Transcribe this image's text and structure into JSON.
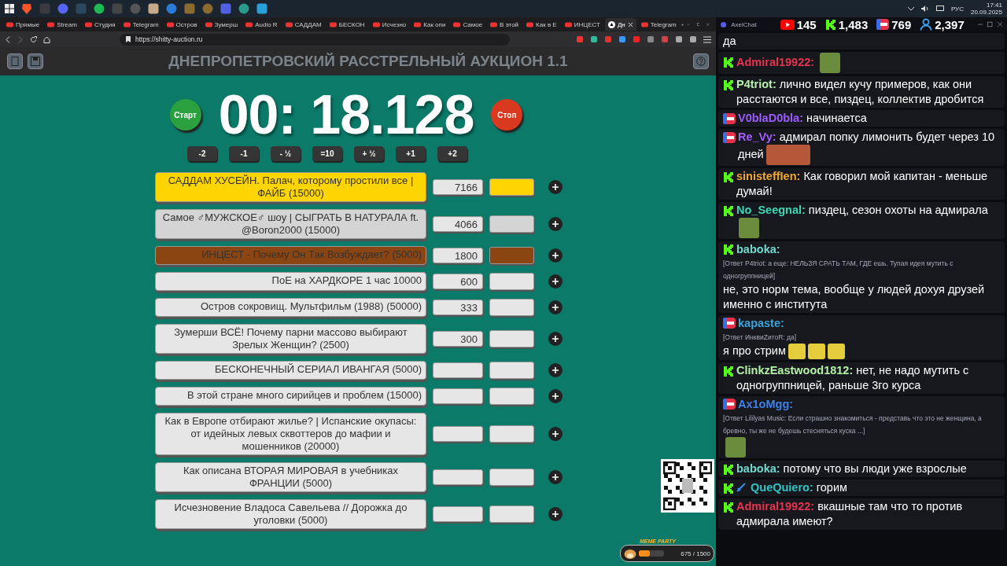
{
  "taskbar": {
    "language": "РУС",
    "time": "17:41",
    "date": "20.09.2025"
  },
  "browser": {
    "tabs": [
      {
        "label": "Прямые",
        "selected": false
      },
      {
        "label": "Stream",
        "selected": false
      },
      {
        "label": "Студия",
        "selected": false
      },
      {
        "label": "Telegram",
        "selected": false
      },
      {
        "label": "Остров",
        "selected": false
      },
      {
        "label": "Зумерш",
        "selected": false
      },
      {
        "label": "Audio R",
        "selected": false
      },
      {
        "label": "САДДАМ",
        "selected": false
      },
      {
        "label": "БЕСКОН",
        "selected": false
      },
      {
        "label": "Исчезно",
        "selected": false
      },
      {
        "label": "Как опи",
        "selected": false
      },
      {
        "label": "Самое",
        "selected": false
      },
      {
        "label": "В этой",
        "selected": false
      },
      {
        "label": "Как в Е",
        "selected": false
      },
      {
        "label": "ИНЦЕСТ",
        "selected": false
      },
      {
        "label": "Дн",
        "selected": true
      },
      {
        "label": "Telegram",
        "selected": false
      }
    ],
    "address": "https://shitty-auction.ru"
  },
  "auction": {
    "title": "ДНЕПРОПЕТРОВСКИЙ РАССТРЕЛЬНЫЙ АУКЦИОН 1.1",
    "timer": "00: 18.128",
    "start_button": "Старт",
    "stop_button": "Стоп",
    "time_buttons": [
      "-2",
      "-1",
      "- ½",
      "=10",
      "+ ½",
      "+1",
      "+2"
    ],
    "lots": [
      {
        "name": "САДДАМ ХУСЕЙН. Палач, которому простили все | ФАЙБ (15000)",
        "amount": "7166",
        "color": "#ffd500"
      },
      {
        "name": "Самое ♂МУЖСКОЕ♂ шоу | СЫГРАТЬ В НАТУРАЛА ft. @Boron2000 (15000)",
        "amount": "4066",
        "color": "#d4d4d4"
      },
      {
        "name": "ИНЦЕСТ - Почему Он Так Возбуждает? (5000)",
        "amount": "1800",
        "color": "#8b4513"
      },
      {
        "name": "ПоЕ на ХАРДКОРЕ 1 час 10000",
        "amount": "600",
        "color": "#e6e6e6"
      },
      {
        "name": "Остров сокровищ. Мультфильм (1988) (50000)",
        "amount": "333",
        "color": "#e6e6e6"
      },
      {
        "name": "Зумерши ВСЁ! Почему парни массово выбирают Зрелых Женщин? (2500)",
        "amount": "300",
        "color": "#e6e6e6"
      },
      {
        "name": "БЕСКОНЕЧНЫЙ СЕРИАЛ ИВАНГАЯ (5000)",
        "color": "#e6e6e6"
      },
      {
        "name": "В этой стране много сирийцев и проблем (15000)",
        "color": "#e6e6e6"
      },
      {
        "name": "Как в Европе отбирают жилье? | Испанские окупасы: от идейных левых сквоттеров до мафии и мошенников (20000)",
        "color": "#e6e6e6"
      },
      {
        "name": "Как описана ВТОРАЯ МИРОВАЯ в учебниках ФРАНЦИИ (5000)",
        "color": "#e6e6e6"
      },
      {
        "name": "Исчезновение Владоса Савельева // Дорожка до уголовки (5000)",
        "color": "#e6e6e6"
      }
    ]
  },
  "widget": {
    "title": "MEME PARTY",
    "progress": "675 / 1500",
    "level": 0.45
  },
  "chat": {
    "title": "AxelChat",
    "counters": [
      {
        "kind": "youtube",
        "value": "145"
      },
      {
        "kind": "kick",
        "value": "1,483"
      },
      {
        "kind": "live",
        "value": "769"
      },
      {
        "kind": "viewers",
        "value": "2,397"
      }
    ],
    "messages": [
      {
        "kind": "plain",
        "text": "да"
      },
      {
        "kind": "kick",
        "author": "Admiral19922:",
        "color": "#e8334f",
        "emotes": [
          {
            "kind": "square"
          }
        ]
      },
      {
        "kind": "kick",
        "author": "P4triot:",
        "color": "#b8f0b0",
        "text": "лично видел кучу примеров, как они расстаются и все, пиздец, коллектив дробится"
      },
      {
        "kind": "live",
        "author": "V0blaD0bla:",
        "color": "#9d5cff",
        "text": "начинаетса"
      },
      {
        "kind": "live",
        "author": "Re_Vy:",
        "color": "#a35dff",
        "text": "адмирал попку лимонить будет через 10 дней",
        "emotes": [
          {
            "kind": "wide"
          }
        ]
      },
      {
        "kind": "kick",
        "author": "sinisteffIen:",
        "color": "#f0a830",
        "text": "Как говорил мой капитан - меньше думай!"
      },
      {
        "kind": "kick",
        "author": "No_Seegnal:",
        "color": "#3ed6b4",
        "text": "пиздец, сезон охоты на адмирала",
        "emotes": [
          {
            "kind": "square"
          }
        ]
      },
      {
        "kind": "kick",
        "author": "baboka:",
        "color": "#72d8cc",
        "reply": "[Ответ P4triot: а еще: НЕЛЬЗЯ СРАТЬ ТАМ, ГДЕ ешь. Тупая идея мутить с одногруппницей]",
        "text": "не, это норм тема, вообще у людей дохуя друзей именно с института"
      },
      {
        "kind": "live",
        "author": "kapaste:",
        "color": "#3aa3da",
        "reply": "[Ответ ИнквиZитоR: да]",
        "text": "я про стрим",
        "emotes": [
          {
            "kind": "small"
          },
          {
            "kind": "small"
          },
          {
            "kind": "small"
          }
        ]
      },
      {
        "kind": "kick",
        "author": "ClinkzEastwood1812:",
        "color": "#b4f0a8",
        "text": "нет, не надо мутить с одногруппницей, раньше 3го курса"
      },
      {
        "kind": "live",
        "author": "Ax1oMgg:",
        "color": "#3d82e6",
        "reply": "[Ответ Lililyas Music: Если страшно знакомиться - представь что это не женщина, а бревно, ты же не будешь стесняться куска ...]",
        "emotes": [
          {
            "kind": "square"
          }
        ]
      },
      {
        "kind": "kick",
        "author": "baboka:",
        "color": "#72d8cc",
        "text": "потому что вы люди уже взрослые"
      },
      {
        "kind": "kick",
        "author": "QueQuiero:",
        "color": "#2ec4c4",
        "badge": true,
        "text": "горим"
      },
      {
        "kind": "kick",
        "author": "Admiral19922:",
        "color": "#e8334f",
        "text": "вкашные там что то против адмирала имеют?"
      }
    ]
  }
}
